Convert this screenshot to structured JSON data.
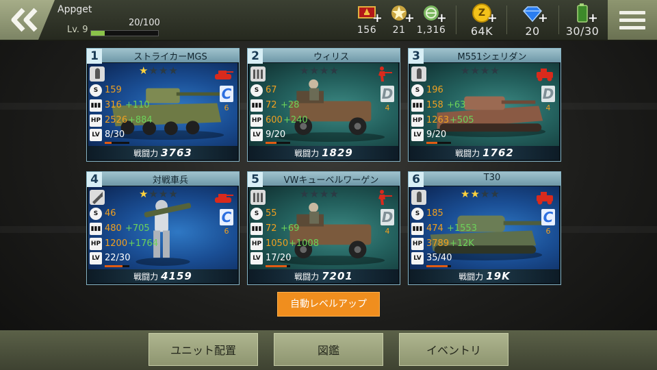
{
  "player": {
    "name": "Appget",
    "level_text": "Lv. 9",
    "xp_text": "20/100",
    "xp_fraction": 0.2
  },
  "resources": [
    {
      "icon": "medal-icon",
      "value": "156"
    },
    {
      "icon": "star-badge-icon",
      "value": "21"
    },
    {
      "icon": "globe-medal-icon",
      "value": "1,316"
    },
    {
      "icon": "gold-coin-icon",
      "value": "64K"
    },
    {
      "icon": "diamond-icon",
      "value": "20"
    },
    {
      "icon": "fuel-can-icon",
      "value": "30/30"
    }
  ],
  "coin_letter": "Z",
  "stat_icons": {
    "s": "S",
    "hp": "HP",
    "lv": "LV"
  },
  "power_label": "戦闘力",
  "units": [
    {
      "num": "1",
      "name": "ストライカーMGS",
      "stars": 1,
      "weapon": "shell",
      "role": "tank",
      "theme": "blue",
      "cost": "159",
      "ammo": "316",
      "ammo_bonus": "+110",
      "hp": "2526",
      "hp_bonus": "+884",
      "lv": "8/30",
      "lv_fraction": 0.27,
      "grade": "C",
      "grade_num": "6",
      "power": "3763"
    },
    {
      "num": "2",
      "name": "ウィリス",
      "stars": 0,
      "weapon": "bullets",
      "role": "infantry",
      "theme": "teal",
      "cost": "67",
      "ammo": "72",
      "ammo_bonus": "+28",
      "hp": "600",
      "hp_bonus": "+240",
      "lv": "9/20",
      "lv_fraction": 0.45,
      "grade": "D",
      "grade_num": "4",
      "power": "1829"
    },
    {
      "num": "3",
      "name": "M551シェリダン",
      "stars": 0,
      "weapon": "shell",
      "role": "vehicle",
      "theme": "teal",
      "cost": "196",
      "ammo": "158",
      "ammo_bonus": "+63",
      "hp": "1263",
      "hp_bonus": "+505",
      "lv": "9/20",
      "lv_fraction": 0.45,
      "grade": "D",
      "grade_num": "4",
      "power": "1762"
    },
    {
      "num": "4",
      "name": "対戦車兵",
      "stars": 1,
      "weapon": "rocket",
      "role": "tank",
      "theme": "blue",
      "cost": "46",
      "ammo": "480",
      "ammo_bonus": "+705",
      "hp": "1200",
      "hp_bonus": "+1764",
      "lv": "22/30",
      "lv_fraction": 0.73,
      "grade": "C",
      "grade_num": "6",
      "power": "4159"
    },
    {
      "num": "5",
      "name": "VWキューベルワーゲン",
      "stars": 0,
      "weapon": "bullets",
      "role": "infantry",
      "theme": "teal",
      "cost": "55",
      "ammo": "72",
      "ammo_bonus": "+69",
      "hp": "1050",
      "hp_bonus": "+1008",
      "lv": "17/20",
      "lv_fraction": 0.85,
      "grade": "D",
      "grade_num": "4",
      "power": "7201"
    },
    {
      "num": "6",
      "name": "T30",
      "stars": 2,
      "weapon": "shell",
      "role": "vehicle",
      "theme": "blue",
      "cost": "185",
      "ammo": "474",
      "ammo_bonus": "+1553",
      "hp": "3789",
      "hp_bonus": "+12K",
      "lv": "35/40",
      "lv_fraction": 0.87,
      "grade": "C",
      "grade_num": "6",
      "power": "19K"
    }
  ],
  "auto_level_label": "自動レベルアップ",
  "bottom_buttons": [
    "ユニット配置",
    "図鑑",
    "イベントリ"
  ],
  "colors": {
    "accent_orange": "#f08e1e",
    "bonus_green": "#6cd25a",
    "stat_orange": "#f0a020",
    "role_red": "#d92a1c"
  }
}
